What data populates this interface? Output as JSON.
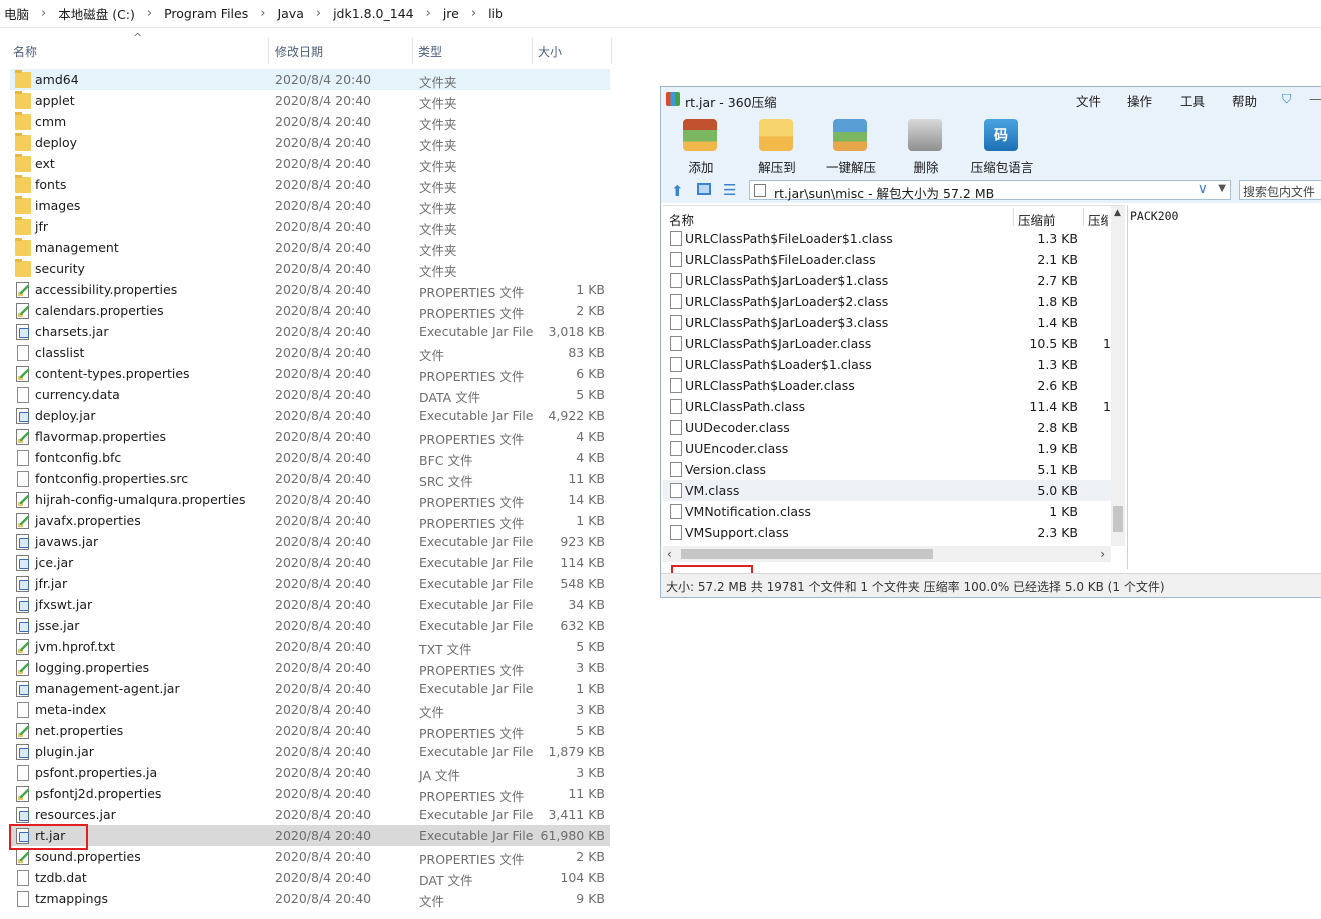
{
  "explorer": {
    "breadcrumb": [
      "电脑",
      "本地磁盘 (C:)",
      "Program Files",
      "Java",
      "jdk1.8.0_144",
      "jre",
      "lib"
    ],
    "columns": {
      "name": "名称",
      "date": "修改日期",
      "type": "类型",
      "size": "大小"
    },
    "rows": [
      {
        "name": "amd64",
        "date": "2020/8/4 20:40",
        "type": "文件夹",
        "size": "",
        "icon": "folder"
      },
      {
        "name": "applet",
        "date": "2020/8/4 20:40",
        "type": "文件夹",
        "size": "",
        "icon": "folder"
      },
      {
        "name": "cmm",
        "date": "2020/8/4 20:40",
        "type": "文件夹",
        "size": "",
        "icon": "folder"
      },
      {
        "name": "deploy",
        "date": "2020/8/4 20:40",
        "type": "文件夹",
        "size": "",
        "icon": "folder"
      },
      {
        "name": "ext",
        "date": "2020/8/4 20:40",
        "type": "文件夹",
        "size": "",
        "icon": "folder"
      },
      {
        "name": "fonts",
        "date": "2020/8/4 20:40",
        "type": "文件夹",
        "size": "",
        "icon": "folder"
      },
      {
        "name": "images",
        "date": "2020/8/4 20:40",
        "type": "文件夹",
        "size": "",
        "icon": "folder"
      },
      {
        "name": "jfr",
        "date": "2020/8/4 20:40",
        "type": "文件夹",
        "size": "",
        "icon": "folder"
      },
      {
        "name": "management",
        "date": "2020/8/4 20:40",
        "type": "文件夹",
        "size": "",
        "icon": "folder"
      },
      {
        "name": "security",
        "date": "2020/8/4 20:40",
        "type": "文件夹",
        "size": "",
        "icon": "folder"
      },
      {
        "name": "accessibility.properties",
        "date": "2020/8/4 20:40",
        "type": "PROPERTIES 文件",
        "size": "1 KB",
        "icon": "prop"
      },
      {
        "name": "calendars.properties",
        "date": "2020/8/4 20:40",
        "type": "PROPERTIES 文件",
        "size": "2 KB",
        "icon": "prop"
      },
      {
        "name": "charsets.jar",
        "date": "2020/8/4 20:40",
        "type": "Executable Jar File",
        "size": "3,018 KB",
        "icon": "jar"
      },
      {
        "name": "classlist",
        "date": "2020/8/4 20:40",
        "type": "文件",
        "size": "83 KB",
        "icon": "plain"
      },
      {
        "name": "content-types.properties",
        "date": "2020/8/4 20:40",
        "type": "PROPERTIES 文件",
        "size": "6 KB",
        "icon": "prop"
      },
      {
        "name": "currency.data",
        "date": "2020/8/4 20:40",
        "type": "DATA 文件",
        "size": "5 KB",
        "icon": "plain"
      },
      {
        "name": "deploy.jar",
        "date": "2020/8/4 20:40",
        "type": "Executable Jar File",
        "size": "4,922 KB",
        "icon": "jar"
      },
      {
        "name": "flavormap.properties",
        "date": "2020/8/4 20:40",
        "type": "PROPERTIES 文件",
        "size": "4 KB",
        "icon": "prop"
      },
      {
        "name": "fontconfig.bfc",
        "date": "2020/8/4 20:40",
        "type": "BFC 文件",
        "size": "4 KB",
        "icon": "plain"
      },
      {
        "name": "fontconfig.properties.src",
        "date": "2020/8/4 20:40",
        "type": "SRC 文件",
        "size": "11 KB",
        "icon": "plain"
      },
      {
        "name": "hijrah-config-umalqura.properties",
        "date": "2020/8/4 20:40",
        "type": "PROPERTIES 文件",
        "size": "14 KB",
        "icon": "prop"
      },
      {
        "name": "javafx.properties",
        "date": "2020/8/4 20:40",
        "type": "PROPERTIES 文件",
        "size": "1 KB",
        "icon": "prop"
      },
      {
        "name": "javaws.jar",
        "date": "2020/8/4 20:40",
        "type": "Executable Jar File",
        "size": "923 KB",
        "icon": "jar"
      },
      {
        "name": "jce.jar",
        "date": "2020/8/4 20:40",
        "type": "Executable Jar File",
        "size": "114 KB",
        "icon": "jar"
      },
      {
        "name": "jfr.jar",
        "date": "2020/8/4 20:40",
        "type": "Executable Jar File",
        "size": "548 KB",
        "icon": "jar"
      },
      {
        "name": "jfxswt.jar",
        "date": "2020/8/4 20:40",
        "type": "Executable Jar File",
        "size": "34 KB",
        "icon": "jar"
      },
      {
        "name": "jsse.jar",
        "date": "2020/8/4 20:40",
        "type": "Executable Jar File",
        "size": "632 KB",
        "icon": "jar"
      },
      {
        "name": "jvm.hprof.txt",
        "date": "2020/8/4 20:40",
        "type": "TXT 文件",
        "size": "5 KB",
        "icon": "prop"
      },
      {
        "name": "logging.properties",
        "date": "2020/8/4 20:40",
        "type": "PROPERTIES 文件",
        "size": "3 KB",
        "icon": "prop"
      },
      {
        "name": "management-agent.jar",
        "date": "2020/8/4 20:40",
        "type": "Executable Jar File",
        "size": "1 KB",
        "icon": "jar"
      },
      {
        "name": "meta-index",
        "date": "2020/8/4 20:40",
        "type": "文件",
        "size": "3 KB",
        "icon": "plain"
      },
      {
        "name": "net.properties",
        "date": "2020/8/4 20:40",
        "type": "PROPERTIES 文件",
        "size": "5 KB",
        "icon": "prop"
      },
      {
        "name": "plugin.jar",
        "date": "2020/8/4 20:40",
        "type": "Executable Jar File",
        "size": "1,879 KB",
        "icon": "jar"
      },
      {
        "name": "psfont.properties.ja",
        "date": "2020/8/4 20:40",
        "type": "JA 文件",
        "size": "3 KB",
        "icon": "plain"
      },
      {
        "name": "psfontj2d.properties",
        "date": "2020/8/4 20:40",
        "type": "PROPERTIES 文件",
        "size": "11 KB",
        "icon": "prop"
      },
      {
        "name": "resources.jar",
        "date": "2020/8/4 20:40",
        "type": "Executable Jar File",
        "size": "3,411 KB",
        "icon": "jar"
      },
      {
        "name": "rt.jar",
        "date": "2020/8/4 20:40",
        "type": "Executable Jar File",
        "size": "61,980 KB",
        "icon": "jar"
      },
      {
        "name": "sound.properties",
        "date": "2020/8/4 20:40",
        "type": "PROPERTIES 文件",
        "size": "2 KB",
        "icon": "prop"
      },
      {
        "name": "tzdb.dat",
        "date": "2020/8/4 20:40",
        "type": "DAT 文件",
        "size": "104 KB",
        "icon": "plain"
      },
      {
        "name": "tzmappings",
        "date": "2020/8/4 20:40",
        "type": "文件",
        "size": "9 KB",
        "icon": "plain"
      }
    ]
  },
  "zip": {
    "title": "rt.jar - 360压缩",
    "menu": [
      "文件",
      "操作",
      "工具",
      "帮助"
    ],
    "tools": [
      {
        "label": "添加",
        "icon": "add-icon"
      },
      {
        "label": "解压到",
        "icon": "extract-icon"
      },
      {
        "label": "一键解压",
        "icon": "one-click-extract-icon"
      },
      {
        "label": "删除",
        "icon": "delete-icon"
      },
      {
        "label": "压缩包语言",
        "icon": "archive-language-icon",
        "glyph": "码"
      }
    ],
    "address": "rt.jar\\sun\\misc - 解包大小为 57.2 MB",
    "search_placeholder": "搜索包内文件",
    "columns": {
      "name": "名称",
      "before": "压缩前",
      "after": "压缩"
    },
    "rows": [
      {
        "name": "URLClassPath$FileLoader$1.class",
        "size": "1.3 KB",
        "extra": ""
      },
      {
        "name": "URLClassPath$FileLoader.class",
        "size": "2.1 KB",
        "extra": ""
      },
      {
        "name": "URLClassPath$JarLoader$1.class",
        "size": "2.7 KB",
        "extra": ""
      },
      {
        "name": "URLClassPath$JarLoader$2.class",
        "size": "1.8 KB",
        "extra": ""
      },
      {
        "name": "URLClassPath$JarLoader$3.class",
        "size": "1.4 KB",
        "extra": ""
      },
      {
        "name": "URLClassPath$JarLoader.class",
        "size": "10.5 KB",
        "extra": "1"
      },
      {
        "name": "URLClassPath$Loader$1.class",
        "size": "1.3 KB",
        "extra": ""
      },
      {
        "name": "URLClassPath$Loader.class",
        "size": "2.6 KB",
        "extra": ""
      },
      {
        "name": "URLClassPath.class",
        "size": "11.4 KB",
        "extra": "1"
      },
      {
        "name": "UUDecoder.class",
        "size": "2.8 KB",
        "extra": ""
      },
      {
        "name": "UUEncoder.class",
        "size": "1.9 KB",
        "extra": ""
      },
      {
        "name": "Version.class",
        "size": "5.1 KB",
        "extra": ""
      },
      {
        "name": "VM.class",
        "size": "5.0 KB",
        "extra": ""
      },
      {
        "name": "VMNotification.class",
        "size": "1 KB",
        "extra": ""
      },
      {
        "name": "VMSupport.class",
        "size": "2.3 KB",
        "extra": ""
      }
    ],
    "preview": "PACK200",
    "status": "大小: 57.2 MB 共 19781 个文件和 1 个文件夹 压缩率 100.0% 已经选择 5.0 KB (1 个文件)"
  },
  "colors": {
    "highlight_red": "#e02020",
    "selected_row": "#d9d9d9",
    "hover_row": "#e5f3fb",
    "zip_chrome": "#e9f1fb"
  }
}
